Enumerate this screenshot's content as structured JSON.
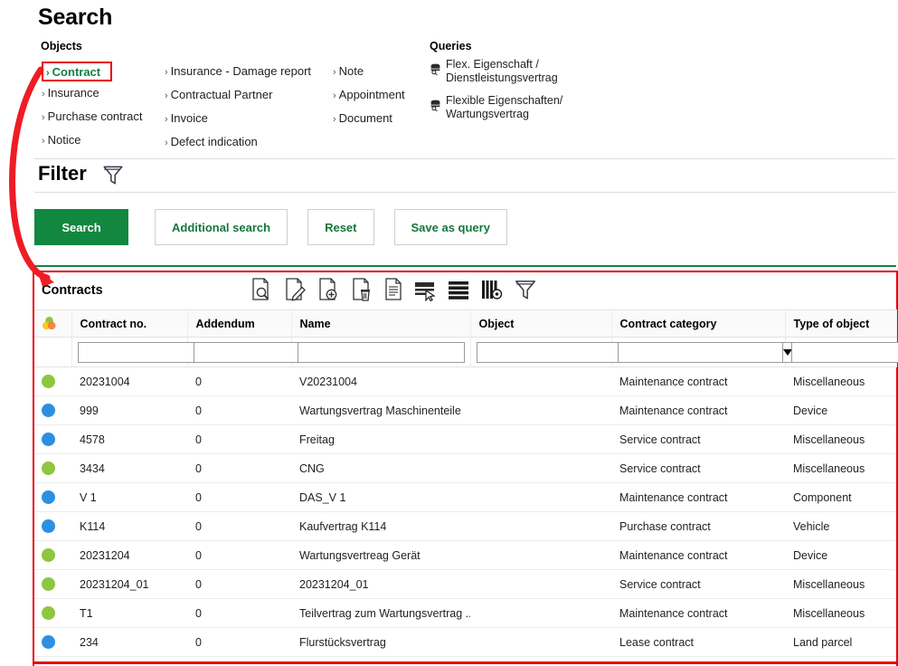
{
  "page": {
    "title": "Search",
    "accent_green": "#12873f",
    "accent_red": "#e8000d",
    "status_green": "#8dc63f",
    "status_blue": "#2d8fe0"
  },
  "objects": {
    "label": "Objects",
    "col1": [
      {
        "label": "Contract",
        "selected": true
      },
      {
        "label": "Insurance",
        "selected": false
      },
      {
        "label": "Purchase contract",
        "selected": false
      },
      {
        "label": "Notice",
        "selected": false
      }
    ],
    "col2": [
      {
        "label": "Insurance - Damage report",
        "selected": false
      },
      {
        "label": "Contractual Partner",
        "selected": false
      },
      {
        "label": "Invoice",
        "selected": false
      },
      {
        "label": "Defect indication",
        "selected": false
      }
    ],
    "col3": [
      {
        "label": "Note",
        "selected": false
      },
      {
        "label": "Appointment",
        "selected": false
      },
      {
        "label": "Document",
        "selected": false
      }
    ],
    "chevron": "›"
  },
  "queries": {
    "label": "Queries",
    "items": [
      {
        "label": "Flex. Eigenschaft / Dienstleistungsvertrag",
        "icon": "database-search-icon"
      },
      {
        "label": "Flexible Eigenschaften/ Wartungsvertrag",
        "icon": "database-search-icon"
      }
    ]
  },
  "filter": {
    "title": "Filter",
    "icon": "funnel-icon",
    "buttons": [
      {
        "label": "Search",
        "style": "primary"
      },
      {
        "label": "Additional search",
        "style": "secondary"
      },
      {
        "label": "Reset",
        "style": "secondary"
      },
      {
        "label": "Save as query",
        "style": "secondary"
      }
    ]
  },
  "grid": {
    "title": "Contracts",
    "toolbar": [
      {
        "name": "view-document-icon",
        "tooltip": "View"
      },
      {
        "name": "edit-document-icon",
        "tooltip": "Edit"
      },
      {
        "name": "add-document-icon",
        "tooltip": "New"
      },
      {
        "name": "delete-document-icon",
        "tooltip": "Delete"
      },
      {
        "name": "report-document-icon",
        "tooltip": "Report"
      },
      {
        "name": "select-row-icon",
        "tooltip": "Select rows"
      },
      {
        "name": "list-view-icon",
        "tooltip": "List view"
      },
      {
        "name": "column-settings-icon",
        "tooltip": "Column settings"
      },
      {
        "name": "funnel-icon",
        "tooltip": "Filter"
      }
    ],
    "columns": [
      {
        "key": "status",
        "label": ""
      },
      {
        "key": "contract_no",
        "label": "Contract no."
      },
      {
        "key": "addendum",
        "label": "Addendum"
      },
      {
        "key": "name",
        "label": "Name"
      },
      {
        "key": "object",
        "label": "Object"
      },
      {
        "key": "contract_category",
        "label": "Contract category"
      },
      {
        "key": "type_of_object",
        "label": "Type of object"
      }
    ],
    "filter_row": {
      "contract_no": "",
      "addendum": "",
      "name": "",
      "object": "",
      "object_has_dropdown": true,
      "contract_category": "",
      "contract_category_has_dropdown": true,
      "type_of_object": ""
    },
    "rows": [
      {
        "status": "green",
        "contract_no": "20231004",
        "addendum": "0",
        "name": "V20231004",
        "object": "",
        "contract_category": "Maintenance contract",
        "type_of_object": "Miscellaneous"
      },
      {
        "status": "blue",
        "contract_no": "999",
        "addendum": "0",
        "name": "Wartungsvertrag Maschinenteile",
        "object": "",
        "contract_category": "Maintenance contract",
        "type_of_object": "Device"
      },
      {
        "status": "blue",
        "contract_no": "4578",
        "addendum": "0",
        "name": "Freitag",
        "object": "",
        "contract_category": "Service contract",
        "type_of_object": "Miscellaneous"
      },
      {
        "status": "green",
        "contract_no": "3434",
        "addendum": "0",
        "name": "CNG",
        "object": "",
        "contract_category": "Service contract",
        "type_of_object": "Miscellaneous"
      },
      {
        "status": "blue",
        "contract_no": "V 1",
        "addendum": "0",
        "name": "DAS_V 1",
        "object": "",
        "contract_category": "Maintenance contract",
        "type_of_object": "Component"
      },
      {
        "status": "blue",
        "contract_no": "K114",
        "addendum": "0",
        "name": "Kaufvertrag K114",
        "object": "",
        "contract_category": "Purchase contract",
        "type_of_object": "Vehicle"
      },
      {
        "status": "green",
        "contract_no": "20231204",
        "addendum": "0",
        "name": "Wartungsvertreag Gerät",
        "object": "",
        "contract_category": "Maintenance contract",
        "type_of_object": "Device"
      },
      {
        "status": "green",
        "contract_no": "20231204_01",
        "addendum": "0",
        "name": "20231204_01",
        "object": "",
        "contract_category": "Service contract",
        "type_of_object": "Miscellaneous"
      },
      {
        "status": "green",
        "contract_no": "T1",
        "addendum": "0",
        "name": "Teilvertrag zum Wartungsvertrag ...",
        "object": "",
        "contract_category": "Maintenance contract",
        "type_of_object": "Miscellaneous"
      },
      {
        "status": "blue",
        "contract_no": "234",
        "addendum": "0",
        "name": "Flurstücksvertrag",
        "object": "",
        "contract_category": "Lease contract",
        "type_of_object": "Land parcel"
      }
    ]
  },
  "annotations": {
    "arrow": {
      "name": "red-curved-arrow",
      "from": "object-link-contract",
      "to": "contracts-grid"
    },
    "highlight_box_object": "Contract",
    "highlight_box_grid": "Contracts"
  }
}
